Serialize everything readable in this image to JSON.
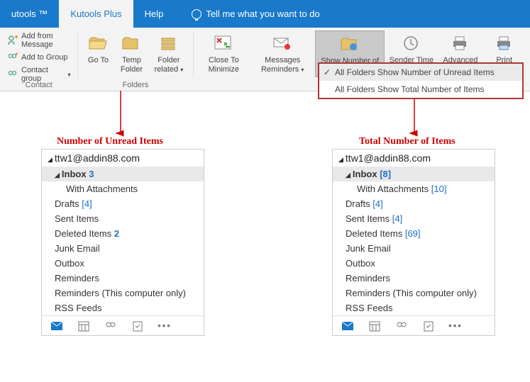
{
  "titlebar": {
    "tabs": [
      "utools ™",
      "Kutools Plus",
      "Help"
    ],
    "tell_me": "Tell me what you want to do"
  },
  "ribbon": {
    "contact": {
      "add_from_message": "Add from Message",
      "add_to_group": "Add to Group",
      "contact_group": "Contact group",
      "label": "Contact"
    },
    "folders": {
      "goto": "Go To",
      "temp_folder": "Temp Folder",
      "folder_related": "Folder related",
      "label": "Folders"
    },
    "view": {
      "close_to_minimize": "Close To Minimize",
      "messages_reminders": "Messages Reminders",
      "show_number_of_items": "Show Number of Items",
      "sender_time_zone": "Sender Time Zone",
      "advanced_print": "Advanced Print",
      "print_selection": "Print Selection"
    }
  },
  "dropdown": {
    "item1": "All Folders Show Number of Unread Items",
    "item2": "All Folders Show Total Number of Items"
  },
  "labels": {
    "unread": "Number of Unread Items",
    "total": "Total Number of Items"
  },
  "panel_left": {
    "account": "ttw1@addin88.com",
    "folders": [
      {
        "name": "Inbox",
        "count": "3",
        "style": "bold",
        "sel": true,
        "indent": 0,
        "tri": true
      },
      {
        "name": "With Attachments",
        "count": "",
        "style": "",
        "sel": false,
        "indent": 1,
        "tri": false
      },
      {
        "name": "Drafts",
        "count": "[4]",
        "style": "blue",
        "sel": false,
        "indent": 0,
        "tri": false
      },
      {
        "name": "Sent Items",
        "count": "",
        "style": "",
        "sel": false,
        "indent": 0,
        "tri": false
      },
      {
        "name": "Deleted Items",
        "count": "2",
        "style": "bold",
        "sel": false,
        "indent": 0,
        "tri": false
      },
      {
        "name": "Junk Email",
        "count": "",
        "style": "",
        "sel": false,
        "indent": 0,
        "tri": false
      },
      {
        "name": "Outbox",
        "count": "",
        "style": "",
        "sel": false,
        "indent": 0,
        "tri": false
      },
      {
        "name": "Reminders",
        "count": "",
        "style": "",
        "sel": false,
        "indent": 0,
        "tri": false
      },
      {
        "name": "Reminders (This computer only)",
        "count": "",
        "style": "",
        "sel": false,
        "indent": 0,
        "tri": false
      },
      {
        "name": "RSS Feeds",
        "count": "",
        "style": "",
        "sel": false,
        "indent": 0,
        "tri": false
      }
    ]
  },
  "panel_right": {
    "account": "ttw1@addin88.com",
    "folders": [
      {
        "name": "Inbox",
        "count": "[8]",
        "style": "blue",
        "sel": true,
        "indent": 0,
        "tri": true
      },
      {
        "name": "With Attachments",
        "count": "[10]",
        "style": "blue",
        "sel": false,
        "indent": 1,
        "tri": false
      },
      {
        "name": "Drafts",
        "count": "[4]",
        "style": "blue",
        "sel": false,
        "indent": 0,
        "tri": false
      },
      {
        "name": "Sent Items",
        "count": "[4]",
        "style": "blue",
        "sel": false,
        "indent": 0,
        "tri": false
      },
      {
        "name": "Deleted Items",
        "count": "[69]",
        "style": "blue",
        "sel": false,
        "indent": 0,
        "tri": false
      },
      {
        "name": "Junk Email",
        "count": "",
        "style": "",
        "sel": false,
        "indent": 0,
        "tri": false
      },
      {
        "name": "Outbox",
        "count": "",
        "style": "",
        "sel": false,
        "indent": 0,
        "tri": false
      },
      {
        "name": "Reminders",
        "count": "",
        "style": "",
        "sel": false,
        "indent": 0,
        "tri": false
      },
      {
        "name": "Reminders (This computer only)",
        "count": "",
        "style": "blue",
        "sel": false,
        "indent": 0,
        "tri": false
      },
      {
        "name": "RSS Feeds",
        "count": "",
        "style": "",
        "sel": false,
        "indent": 0,
        "tri": false
      }
    ]
  }
}
